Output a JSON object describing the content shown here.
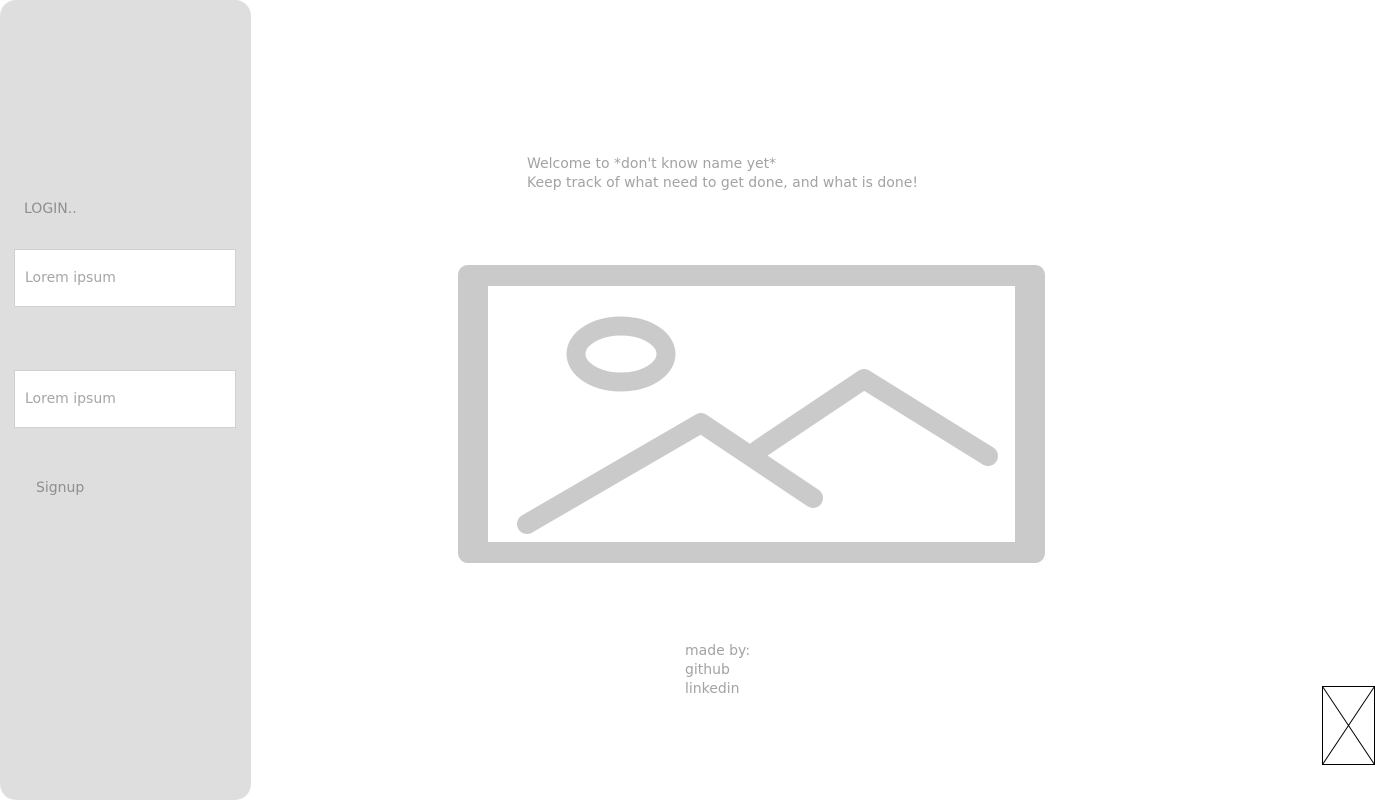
{
  "sidebar": {
    "login_title": "LOGIN..",
    "fields": [
      {
        "placeholder": "Lorem ipsum"
      },
      {
        "placeholder": "Lorem ipsum"
      }
    ],
    "signup_label": "Signup"
  },
  "main": {
    "welcome_line_1": "Welcome to *don't know name yet*",
    "welcome_line_2": "Keep track of what need to get done, and what is done!",
    "hero_icon": "image-placeholder-icon"
  },
  "footer": {
    "made_by_label": "made by:",
    "github_label": "github",
    "linkedin_label": "linkedin"
  },
  "corner": {
    "icon": "image-placeholder-icon"
  },
  "colors": {
    "sidebar_bg": "#dedede",
    "placeholder_gray": "#cacaca",
    "text_gray": "#a3a3a3"
  }
}
